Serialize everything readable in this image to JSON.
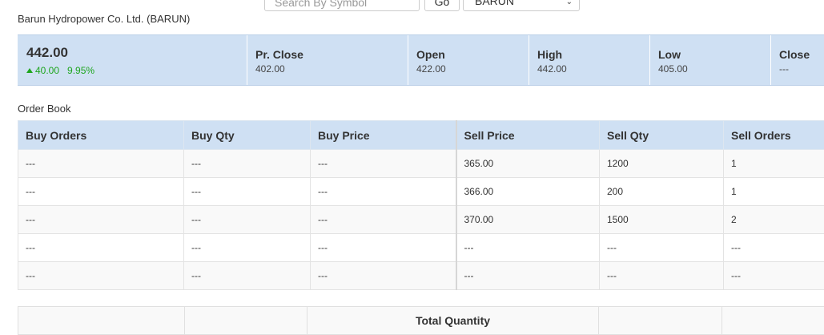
{
  "search": {
    "placeholder": "Search By Symbol",
    "go_label": "Go",
    "selected_symbol": "BARUN"
  },
  "company": {
    "name": "Barun Hydropower Co. Ltd. (BARUN)"
  },
  "summary": {
    "ltp": "442.00",
    "change": "40.00",
    "change_pct": "9.95%",
    "stats": [
      {
        "label": "Pr. Close",
        "value": "402.00"
      },
      {
        "label": "Open",
        "value": "422.00"
      },
      {
        "label": "High",
        "value": "442.00"
      },
      {
        "label": "Low",
        "value": "405.00"
      },
      {
        "label": "Close",
        "value": "---"
      }
    ]
  },
  "order_book": {
    "title": "Order Book",
    "headers": [
      "Buy Orders",
      "Buy Qty",
      "Buy Price",
      "Sell Price",
      "Sell Qty",
      "Sell Orders"
    ],
    "rows": [
      [
        "---",
        "---",
        "---",
        "365.00",
        "1200",
        "1"
      ],
      [
        "---",
        "---",
        "---",
        "366.00",
        "200",
        "1"
      ],
      [
        "---",
        "---",
        "---",
        "370.00",
        "1500",
        "2"
      ],
      [
        "---",
        "---",
        "---",
        "---",
        "---",
        "---"
      ],
      [
        "---",
        "---",
        "---",
        "---",
        "---",
        "---"
      ]
    ]
  },
  "totals": {
    "label": "Total Quantity"
  },
  "colors": {
    "header_bg": "#cfe0f3",
    "positive": "#1ea51e"
  }
}
